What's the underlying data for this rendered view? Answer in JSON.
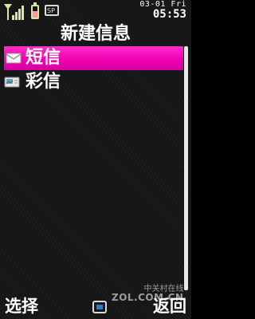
{
  "status_bar": {
    "signal_icon": "signal-strength-icon",
    "battery_icon": "battery-icon",
    "battery_level": 0.6,
    "message_icon": "sms-notification-icon",
    "date": "03-01 Fri",
    "time": "05:53"
  },
  "title": "新建信息",
  "menu": {
    "items": [
      {
        "label": "短信",
        "icon": "envelope-icon",
        "selected": true
      },
      {
        "label": "彩信",
        "icon": "mms-envelope-icon",
        "selected": false
      }
    ]
  },
  "softkeys": {
    "left": "选择",
    "center_icon": "ok-icon",
    "right": "返回"
  },
  "watermark": {
    "cn": "中关村在线",
    "en": "ZOL.COM.CN"
  },
  "colors": {
    "highlight": "#f000b0",
    "scrollbar": "#e9e9e9",
    "background": "#141414"
  }
}
